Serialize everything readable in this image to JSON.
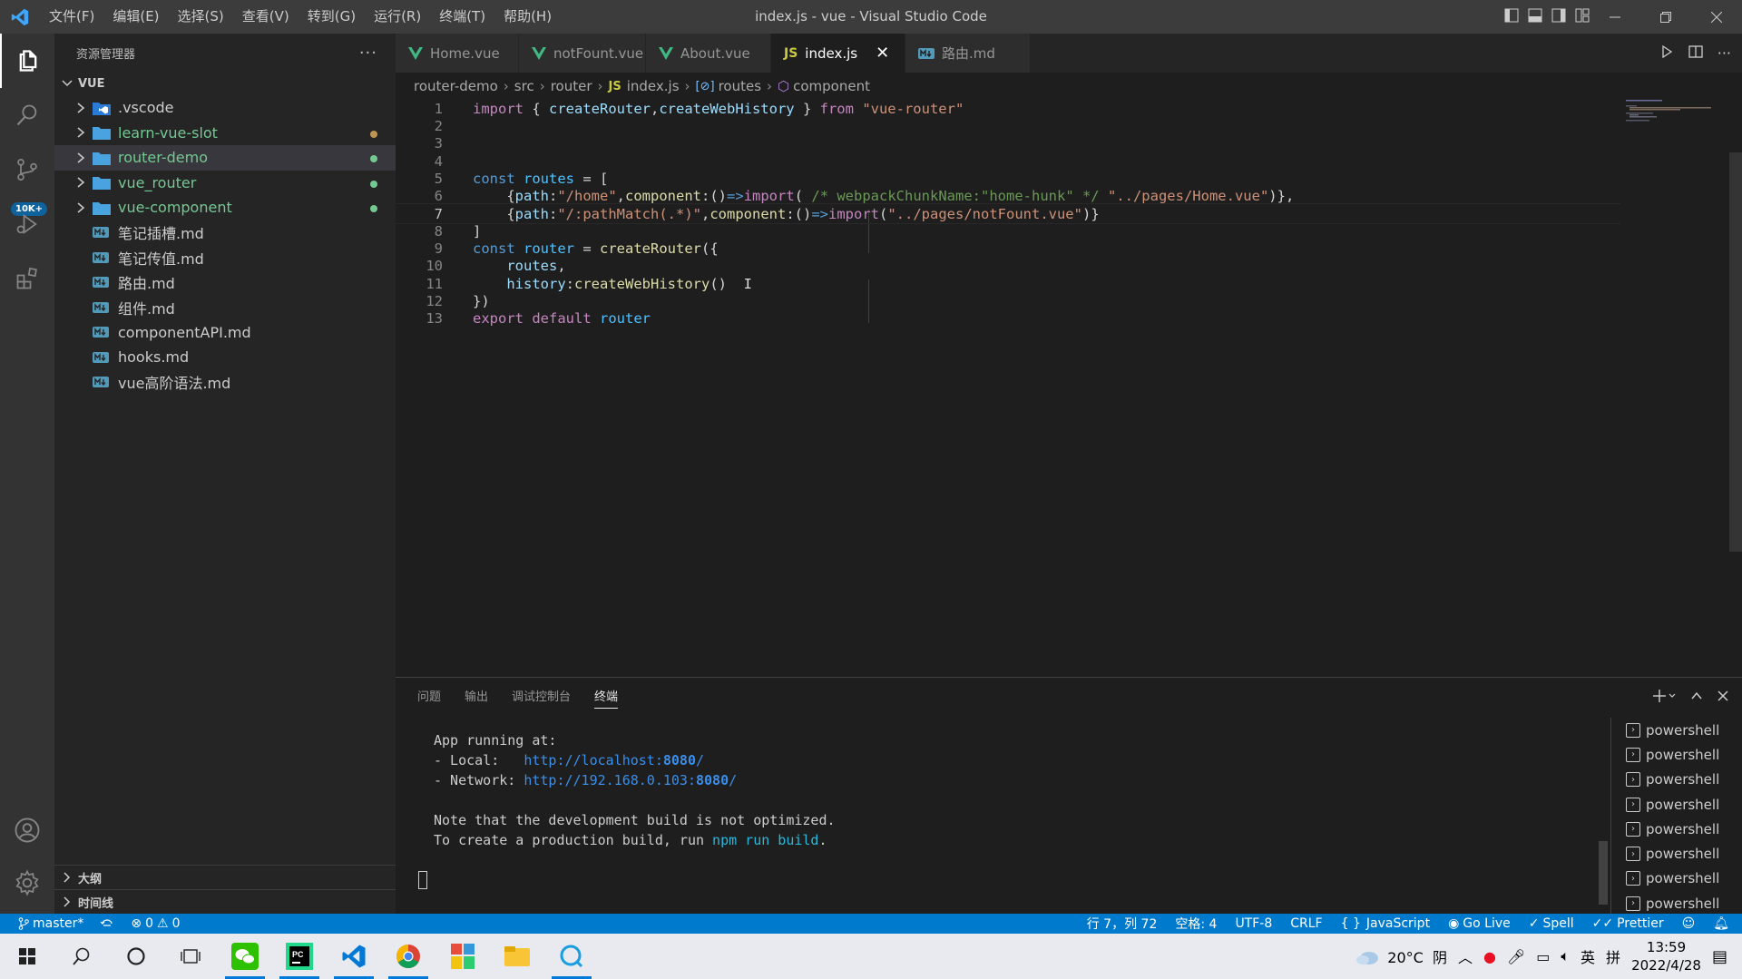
{
  "window": {
    "title": "index.js - vue - Visual Studio Code",
    "menu": [
      "文件(F)",
      "编辑(E)",
      "选择(S)",
      "查看(V)",
      "转到(G)",
      "运行(R)",
      "终端(T)",
      "帮助(H)"
    ]
  },
  "activity_bar": {
    "scm_badge": "10K+"
  },
  "sidebar": {
    "header": "资源管理器",
    "more": "···",
    "section": "VUE",
    "items": [
      {
        "name": ".vscode",
        "type": "folder-vscode",
        "modified": false
      },
      {
        "name": "learn-vue-slot",
        "type": "folder",
        "modified": true,
        "dot": "#c09553"
      },
      {
        "name": "router-demo",
        "type": "folder",
        "modified": true,
        "dot": "#73c991"
      },
      {
        "name": "vue_router",
        "type": "folder",
        "modified": true,
        "dot": "#73c991"
      },
      {
        "name": "vue-component",
        "type": "folder",
        "modified": true,
        "dot": "#73c991"
      },
      {
        "name": "笔记插槽.md",
        "type": "md"
      },
      {
        "name": "笔记传值.md",
        "type": "md"
      },
      {
        "name": "路由.md",
        "type": "md"
      },
      {
        "name": "组件.md",
        "type": "md"
      },
      {
        "name": "componentAPI.md",
        "type": "md"
      },
      {
        "name": "hooks.md",
        "type": "md"
      },
      {
        "name": "vue高阶语法.md",
        "type": "md"
      }
    ],
    "outline": "大纲",
    "timeline": "时间线"
  },
  "tabs": [
    {
      "label": "Home.vue",
      "icon": "vue"
    },
    {
      "label": "notFount.vue",
      "icon": "vue"
    },
    {
      "label": "About.vue",
      "icon": "vue"
    },
    {
      "label": "index.js",
      "icon": "js",
      "active": true,
      "close": "✕"
    },
    {
      "label": "路由.md",
      "icon": "md"
    }
  ],
  "breadcrumb": [
    "router-demo",
    "src",
    "router",
    "index.js",
    "routes",
    "component"
  ],
  "breadcrumb_icons": {
    "js": "JS"
  },
  "code": {
    "line_numbers": [
      "1",
      "2",
      "3",
      "4",
      "5",
      "6",
      "7",
      "8",
      "9",
      "10",
      "11",
      "12",
      "13"
    ],
    "current_line": 7
  },
  "panel": {
    "tabs": [
      "问题",
      "输出",
      "调试控制台",
      "终端"
    ],
    "active_tab": "终端",
    "terminal_lines": {
      "l1": "App running at:",
      "l2_prefix": "- Local:   ",
      "l2_url_a": "http://localhost:",
      "l2_url_port": "8080",
      "l2_url_b": "/",
      "l3_prefix": "- Network: ",
      "l3_url_a": "http://192.168.0.103:",
      "l3_url_port": "8080",
      "l3_url_b": "/",
      "l4": "Note that the development build is not optimized.",
      "l5_prefix": "To create a production build, run ",
      "l5_cmd": "npm run build",
      "l5_suffix": "."
    },
    "terminals": [
      "powershell",
      "powershell",
      "powershell",
      "powershell",
      "powershell",
      "powershell",
      "powershell",
      "powershell"
    ]
  },
  "statusbar": {
    "branch": "master*",
    "errors": "0",
    "warnings": "0",
    "position": "行 7，列 72",
    "spaces": "空格: 4",
    "encoding": "UTF-8",
    "eol": "CRLF",
    "language": "JavaScript",
    "golive": "Go Live",
    "spell": "Spell",
    "prettier": "Prettier"
  },
  "taskbar": {
    "weather": "20°C  阴",
    "ime1": "英",
    "ime2": "拼",
    "time": "13:59",
    "date": "2022/4/28"
  },
  "colors": {
    "accent": "#007acc",
    "folder": "#4aa3df",
    "vue": "#41b883",
    "js": "#cbcb41"
  }
}
